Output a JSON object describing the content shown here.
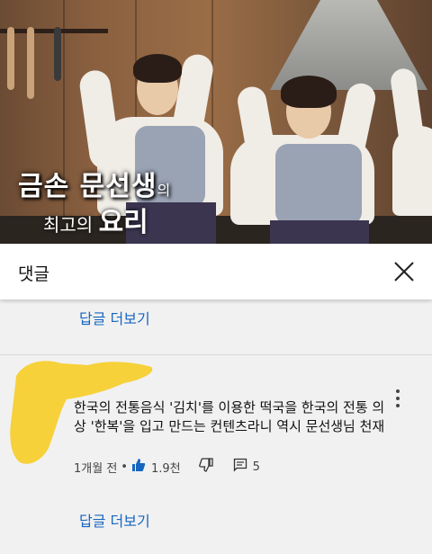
{
  "video": {
    "title_main": "금손 문선생",
    "title_suffix": "의",
    "subtitle_small": "최고의 ",
    "subtitle_big": "요리"
  },
  "comments_panel": {
    "title": "댓글",
    "close_icon": "close-icon"
  },
  "replies_top": {
    "label": "답글 더보기"
  },
  "comment": {
    "text": "한국의 전통음식 '김치'를 이용한 떡국을 한국의 전통 의상 '한복'을 입고 만드는 컨텐츠라니 역시 문선생님 천재",
    "time": "1개월 전",
    "separator": "•",
    "likes": "1.9천",
    "replies": "5",
    "icons": {
      "like": "thumbs-up-icon",
      "dislike": "thumbs-down-icon",
      "reply": "reply-icon",
      "more": "more-vert-icon"
    },
    "accent": "#1565c0"
  },
  "replies_bottom": {
    "label": "답글 더보기"
  }
}
